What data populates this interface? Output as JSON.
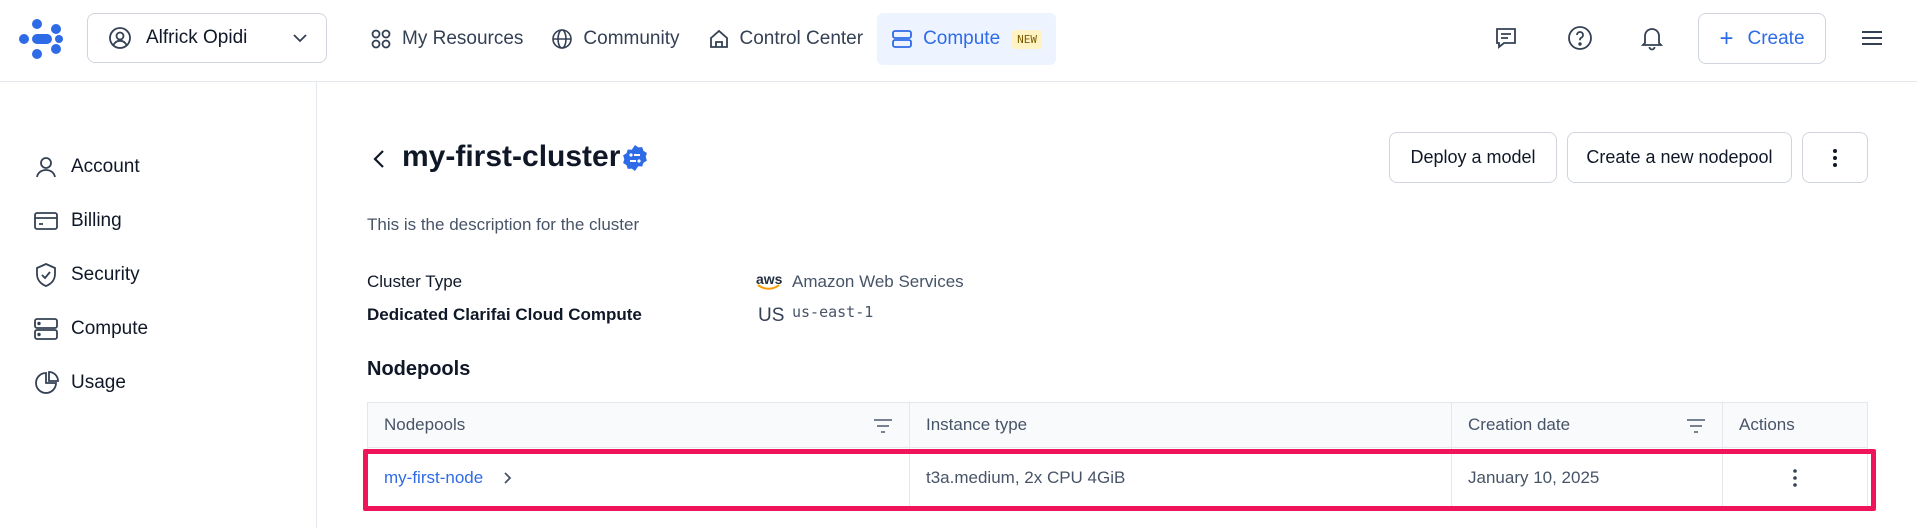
{
  "user": {
    "name": "Alfrick Opidi"
  },
  "nav": [
    {
      "label": "My Resources"
    },
    {
      "label": "Community"
    },
    {
      "label": "Control Center"
    },
    {
      "label": "Compute",
      "badge": "NEW"
    }
  ],
  "header_actions": {
    "create_label": "Create"
  },
  "sidebar": {
    "items": [
      {
        "label": "Account"
      },
      {
        "label": "Billing"
      },
      {
        "label": "Security"
      },
      {
        "label": "Compute"
      },
      {
        "label": "Usage"
      }
    ]
  },
  "cluster": {
    "title": "my-first-cluster",
    "description": "This is the description for the cluster",
    "type_label": "Cluster Type",
    "type_value": "Amazon Web Services",
    "provider_logo_text": "aws",
    "compute_label": "Dedicated Clarifai Cloud Compute",
    "region_flag": "US",
    "region_code": "us-east-1"
  },
  "actions": {
    "deploy_model": "Deploy a model",
    "create_nodepool": "Create a new nodepool"
  },
  "nodepools": {
    "section_title": "Nodepools",
    "columns": [
      "Nodepools",
      "Instance type",
      "Creation date",
      "Actions"
    ],
    "rows": [
      {
        "name": "my-first-node",
        "instance_type": "t3a.medium, 2x CPU 4GiB",
        "created": "January 10, 2025"
      }
    ]
  },
  "colors": {
    "accent": "#2e6be6",
    "highlight": "#f0145a",
    "badge_bg": "#fff3c4"
  }
}
